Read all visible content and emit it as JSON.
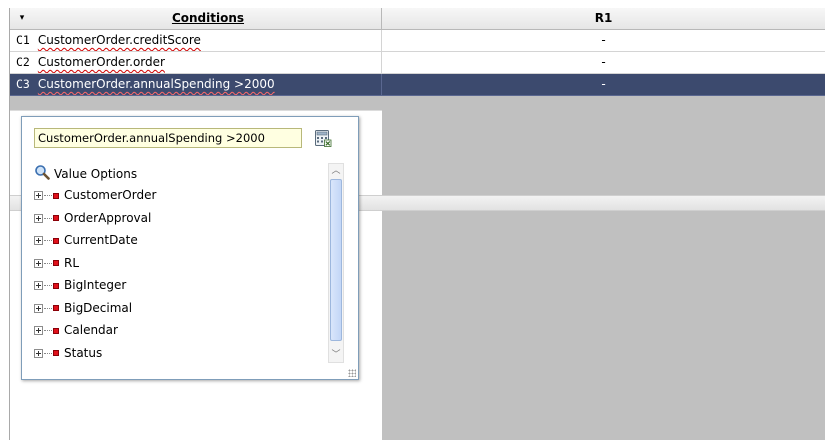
{
  "table": {
    "header": {
      "menu_arrow": "▾",
      "conditions_label": "Conditions",
      "r1_label": "R1"
    },
    "rows": [
      {
        "id": "C1",
        "expr": "CustomerOrder.creditScore",
        "r1": "-"
      },
      {
        "id": "C2",
        "expr": "CustomerOrder.order",
        "r1": "-"
      },
      {
        "id": "C3",
        "expr": "CustomerOrder.annualSpending >2000",
        "r1": "-",
        "selected": true
      }
    ]
  },
  "editor_popup": {
    "input_value": "CustomerOrder.annualSpending >2000",
    "calc_icon": "calculator-icon",
    "value_options_icon": "search-icon",
    "value_options_label": "Value Options",
    "tree_items": [
      {
        "label": "CustomerOrder"
      },
      {
        "label": "OrderApproval"
      },
      {
        "label": "CurrentDate"
      },
      {
        "label": "RL"
      },
      {
        "label": "BigInteger"
      },
      {
        "label": "BigDecimal"
      },
      {
        "label": "Calendar"
      },
      {
        "label": "Status"
      }
    ]
  },
  "colors": {
    "selected_row": "#3c4a6e",
    "grid_background": "#c0c0c0",
    "tree_node_dot": "#e0101a",
    "input_background": "#ffffe1"
  }
}
